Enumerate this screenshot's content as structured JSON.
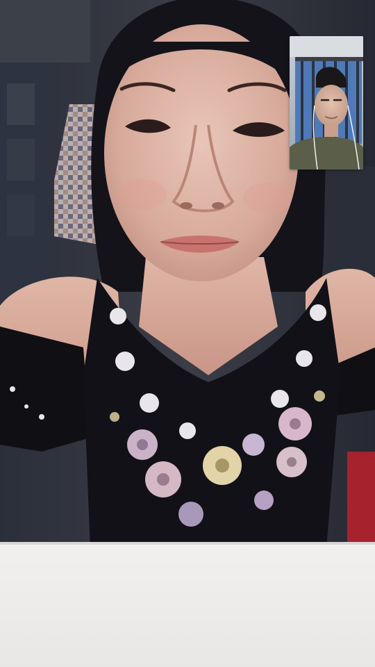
{
  "call": {
    "main_video": "remote-camera-feed",
    "pip_video": "self-camera-preview"
  }
}
